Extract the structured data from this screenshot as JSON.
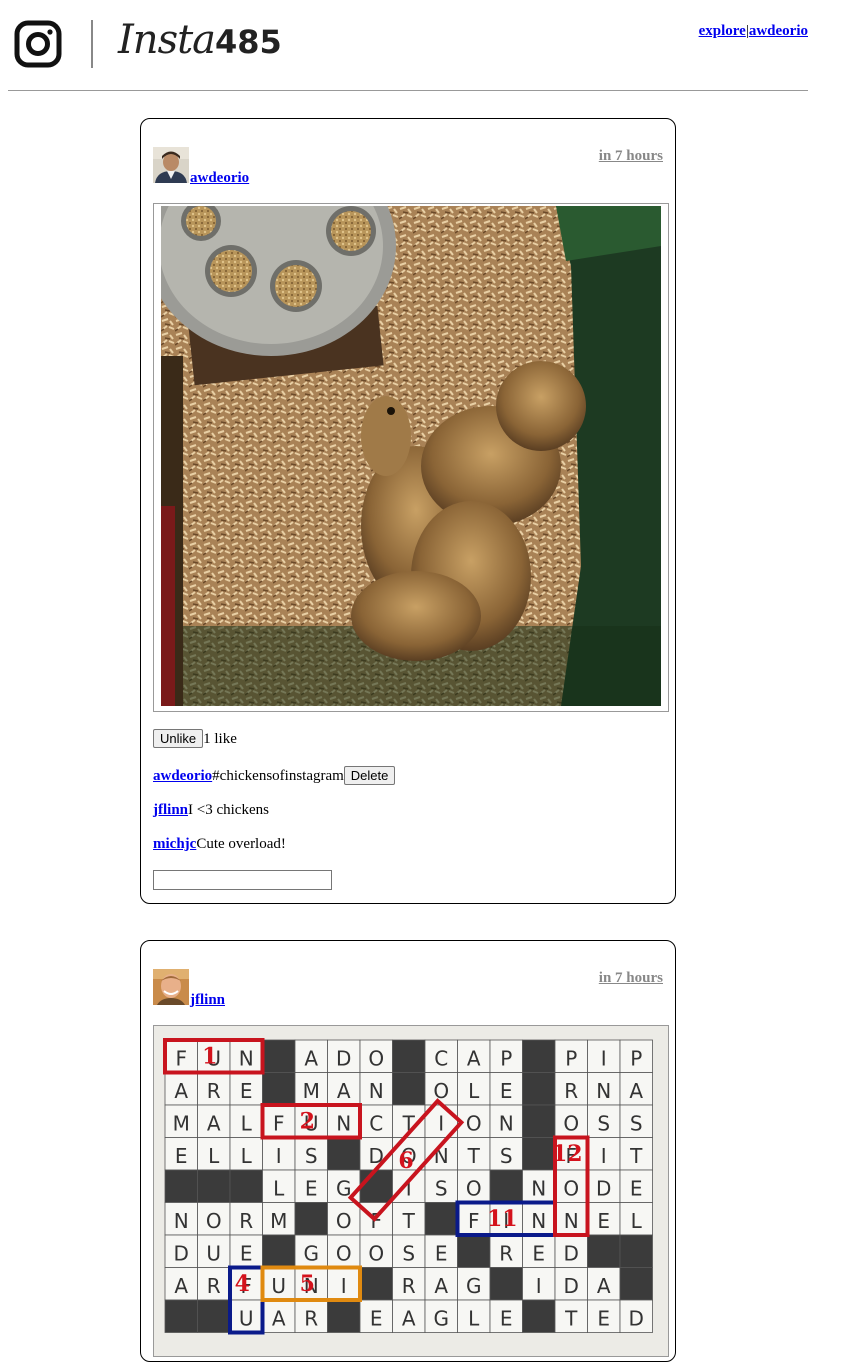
{
  "header": {
    "logo_script": "Insta",
    "logo_number": "485",
    "nav_explore": "explore",
    "nav_separator": "|",
    "nav_user": "awdeorio"
  },
  "posts": [
    {
      "owner": "awdeorio",
      "timestamp": "in 7 hours",
      "image_alt": "chickens photo",
      "like_button": "Unlike",
      "likes_text": "1 like",
      "comments": [
        {
          "owner": "awdeorio",
          "text": "#chickensofinstagram",
          "delete_label": "Delete"
        },
        {
          "owner": "jflinn",
          "text": "I <3 chickens"
        },
        {
          "owner": "michjc",
          "text": "Cute overload!"
        }
      ],
      "comment_input_value": ""
    },
    {
      "owner": "jflinn",
      "timestamp": "in 7 hours",
      "image_alt": "crossword photo",
      "crossword": {
        "rows": [
          "FUN#ADO#CAP#PIP",
          "ARE#MAN#OLE#RNA",
          "MALFUNCTION#OSS",
          "ELLIS#DONTS#FIT",
          "###LEG#ISO#NODE",
          "NORM#OFT#FINNEL",
          "DUE#GOOSE#RED##",
          "ARFUNI#RAG#IDA#",
          "##UAR#EAGLE#TED"
        ],
        "markers": [
          "1",
          "2",
          "4",
          "5",
          "6",
          "11",
          "12"
        ]
      }
    }
  ]
}
